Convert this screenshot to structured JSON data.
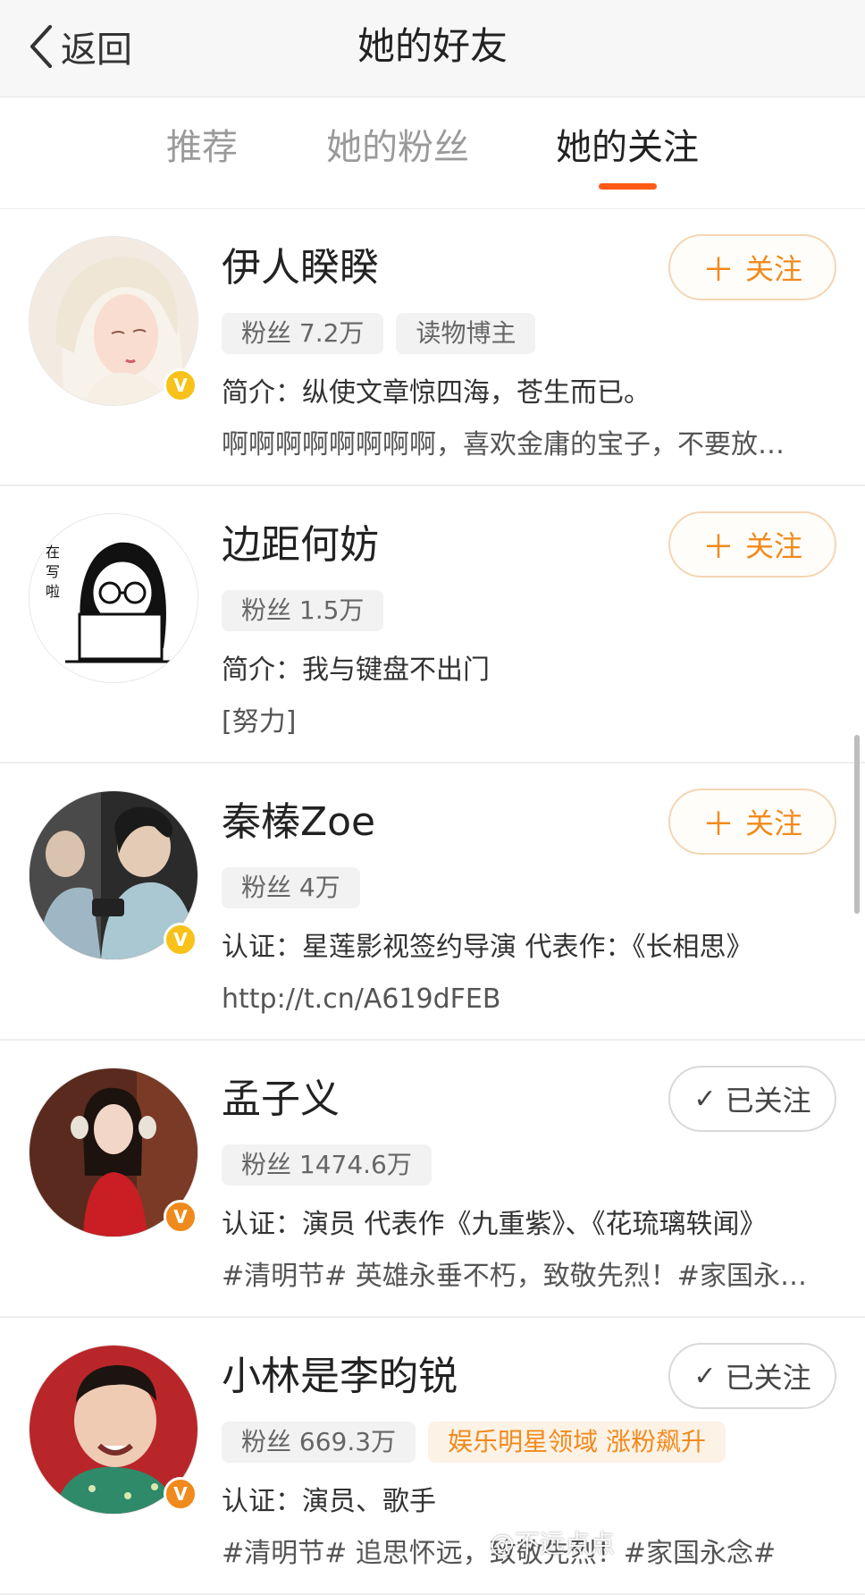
{
  "nav": {
    "back_label": "返回",
    "title": "她的好友"
  },
  "tabs": [
    {
      "label": "推荐",
      "active": false
    },
    {
      "label": "她的粉丝",
      "active": false
    },
    {
      "label": "她的关注",
      "active": true
    }
  ],
  "accent_color": "#ff5a16",
  "users": [
    {
      "name": "伊人睽睽",
      "fans": "粉丝 7.2万",
      "tag": "读物博主",
      "line1": "简介：纵使文章惊四海，苍生而已。",
      "line2": "啊啊啊啊啊啊啊啊，喜欢金庸的宝子，不要放…",
      "verified": "gold",
      "button": {
        "label": "关注",
        "state": "follow",
        "icon": "plus-icon"
      }
    },
    {
      "name": "边距何妨",
      "fans": "粉丝 1.5万",
      "line1": "简介：我与键盘不出门",
      "line2": "[努力]",
      "verified": null,
      "button": {
        "label": "关注",
        "state": "follow",
        "icon": "plus-icon"
      }
    },
    {
      "name": "秦榛Zoe",
      "fans": "粉丝 4万",
      "line1": "认证：星莲影视签约导演 代表作：《长相思》",
      "line2": "http://t.cn/A619dFEB",
      "verified": "gold",
      "button": {
        "label": "关注",
        "state": "follow",
        "icon": "plus-icon"
      }
    },
    {
      "name": "孟子义",
      "fans": "粉丝 1474.6万",
      "line1": "认证：演员 代表作《九重紫》、《花琉璃轶闻》",
      "line2": "#清明节# 英雄永垂不朽，致敬先烈！#家国永…",
      "verified": "orange",
      "button": {
        "label": "已关注",
        "state": "followed",
        "icon": "check-icon"
      }
    },
    {
      "name": "小林是李昀锐",
      "fans": "粉丝 669.3万",
      "tag": "娱乐明星领域 涨粉飙升",
      "line1": "认证：演员、歌手",
      "line2": "#清明节# 追思怀远，致敬先烈！#家国永念#",
      "verified": "orange",
      "button": {
        "label": "已关注",
        "state": "followed",
        "icon": "check-icon"
      }
    }
  ],
  "avatar_drawing": {
    "sketch_text": [
      "在",
      "写",
      "啦"
    ]
  },
  "watermark": "@不远点点"
}
